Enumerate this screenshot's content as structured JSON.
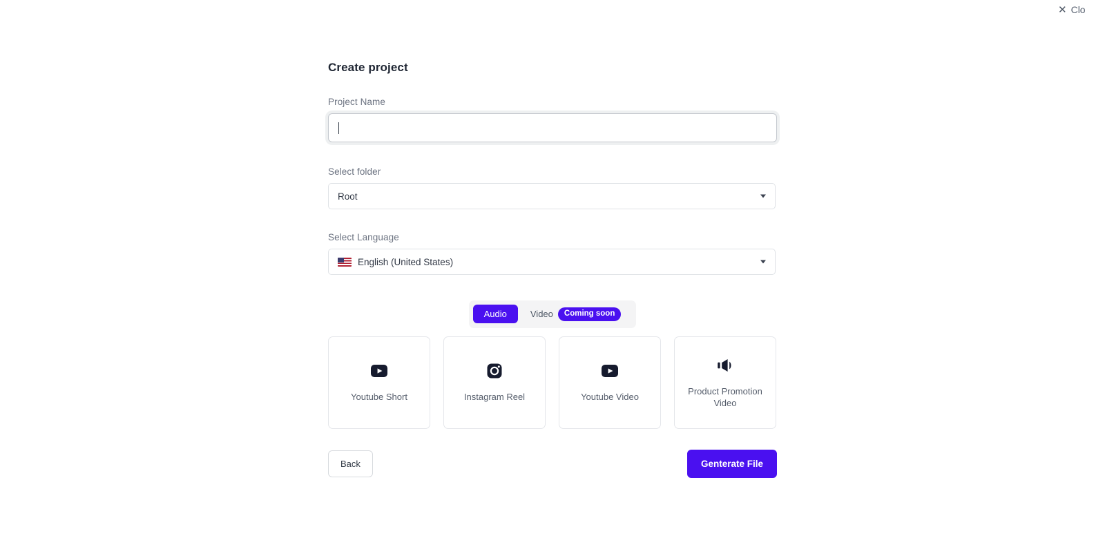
{
  "window": {
    "close_label": "Clo",
    "close_icon": "close-x-icon"
  },
  "dialog": {
    "title": "Create project"
  },
  "project_name": {
    "label": "Project Name",
    "value": "",
    "placeholder": ""
  },
  "folder": {
    "label": "Select folder",
    "selected": "Root",
    "caret_icon": "chevron-down-icon"
  },
  "language": {
    "label": "Select Language",
    "selected": "English (United States)",
    "flag": "🇺🇸",
    "flag_icon": "us-flag-icon",
    "caret_icon": "chevron-down-icon"
  },
  "media_toggle": {
    "options": [
      {
        "label": "Audio",
        "active": true,
        "badge": ""
      },
      {
        "label": "Video",
        "active": false,
        "badge": "Coming soon"
      }
    ]
  },
  "templates": [
    {
      "label": "Youtube Short",
      "icon": "youtube-icon"
    },
    {
      "label": "Instagram Reel",
      "icon": "instagram-icon"
    },
    {
      "label": "Youtube Video",
      "icon": "youtube-icon"
    },
    {
      "label": "Product Promotion Video",
      "icon": "megaphone-icon"
    }
  ],
  "actions": {
    "back_label": "Back",
    "generate_label": "Genterate File"
  },
  "colors": {
    "accent": "#4a10f0",
    "icon_dark": "#161b2e",
    "label_gray": "#6b7280",
    "heading": "#1f2633",
    "border": "#e4e6ea"
  }
}
